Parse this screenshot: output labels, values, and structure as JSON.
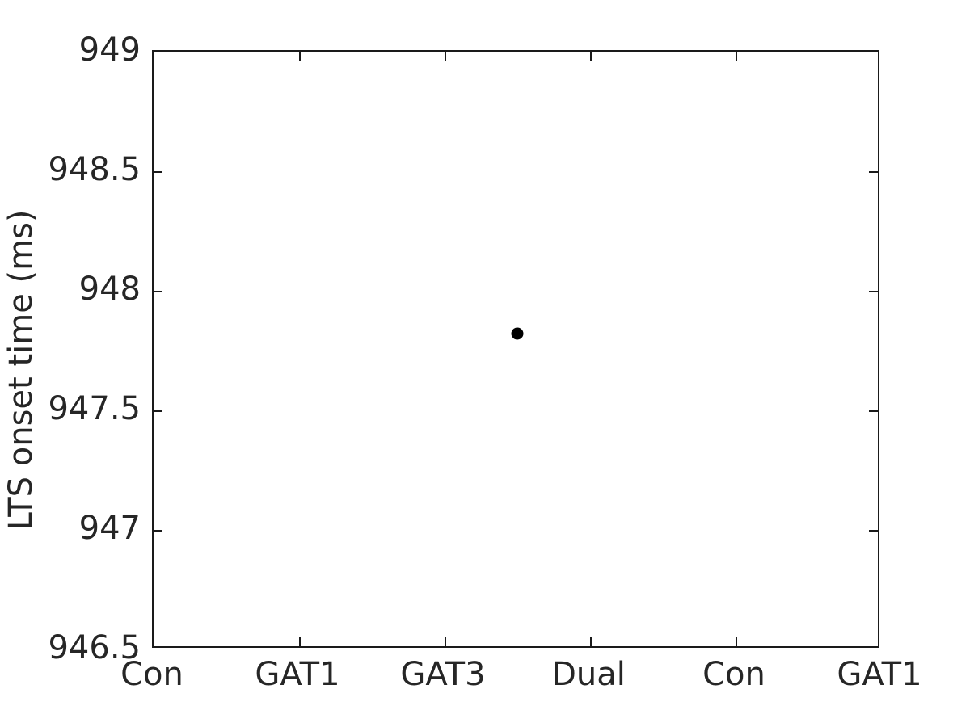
{
  "chart_data": {
    "type": "scatter",
    "title": "",
    "xlabel": "",
    "ylabel": "LTS onset time (ms)",
    "categories": [
      "Con",
      "GAT1",
      "GAT3",
      "Dual",
      "Con",
      "GAT1"
    ],
    "xtick_labels": [
      "Con",
      "GAT1",
      "GAT3",
      "Dual",
      "Con",
      "GAT1"
    ],
    "xtick_positions": [
      1,
      2,
      3,
      4,
      5,
      6
    ],
    "xlim": [
      1,
      6
    ],
    "ytick_labels": [
      "949",
      "948.5",
      "948",
      "947.5",
      "947",
      "946.5"
    ],
    "ytick_values": [
      949,
      948.5,
      948,
      947.5,
      947,
      946.5
    ],
    "ylim": [
      946.5,
      949
    ],
    "grid": false,
    "legend": null,
    "marker": "filled-circle",
    "marker_color": "#000000",
    "points": [
      {
        "x": 3.5,
        "y": 947.82,
        "label": ""
      }
    ],
    "series": [
      {
        "name": "LTS onset time",
        "x": [
          3.5
        ],
        "values": [
          947.82
        ]
      }
    ]
  },
  "axes": {
    "y_title": "LTS onset time (ms)",
    "y_ticks": [
      {
        "label": "949",
        "value": 949
      },
      {
        "label": "948.5",
        "value": 948.5
      },
      {
        "label": "948",
        "value": 948
      },
      {
        "label": "947.5",
        "value": 947.5
      },
      {
        "label": "947",
        "value": 947
      },
      {
        "label": "946.5",
        "value": 946.5
      }
    ],
    "x_ticks": [
      {
        "label": "Con",
        "value": 1
      },
      {
        "label": "GAT1",
        "value": 2
      },
      {
        "label": "GAT3",
        "value": 3
      },
      {
        "label": "Dual",
        "value": 4
      },
      {
        "label": "Con",
        "value": 5
      },
      {
        "label": "GAT1",
        "value": 6
      }
    ]
  },
  "style": {
    "axis_color": "#1a1a1a",
    "text_color": "#262626",
    "marker_color": "#000000",
    "background": "#ffffff"
  }
}
